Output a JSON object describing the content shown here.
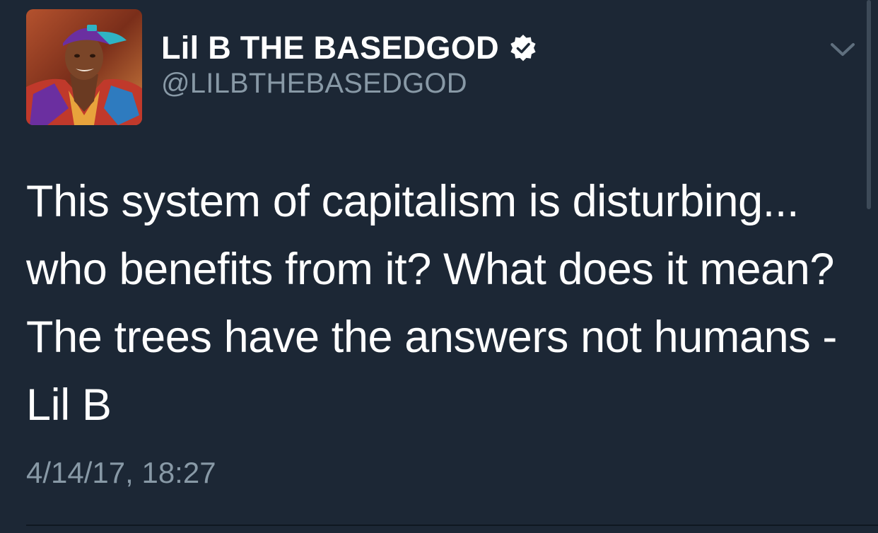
{
  "tweet": {
    "author": {
      "display_name": "Lil B THE BASEDGOD",
      "handle": "@LILBTHEBASEDGOD",
      "verified": true
    },
    "text_lines": [
      "This system of capitalism is disturbing...",
      "who benefits from it? What does it mean?",
      "The trees have the answers not humans  -",
      "Lil B"
    ],
    "timestamp": "4/14/17, 18:27"
  },
  "colors": {
    "background": "#1c2735",
    "primary_text": "#ffffff",
    "secondary_text": "#8899a6"
  },
  "icons": {
    "verified": "verified-badge-icon",
    "menu": "chevron-down-icon"
  }
}
